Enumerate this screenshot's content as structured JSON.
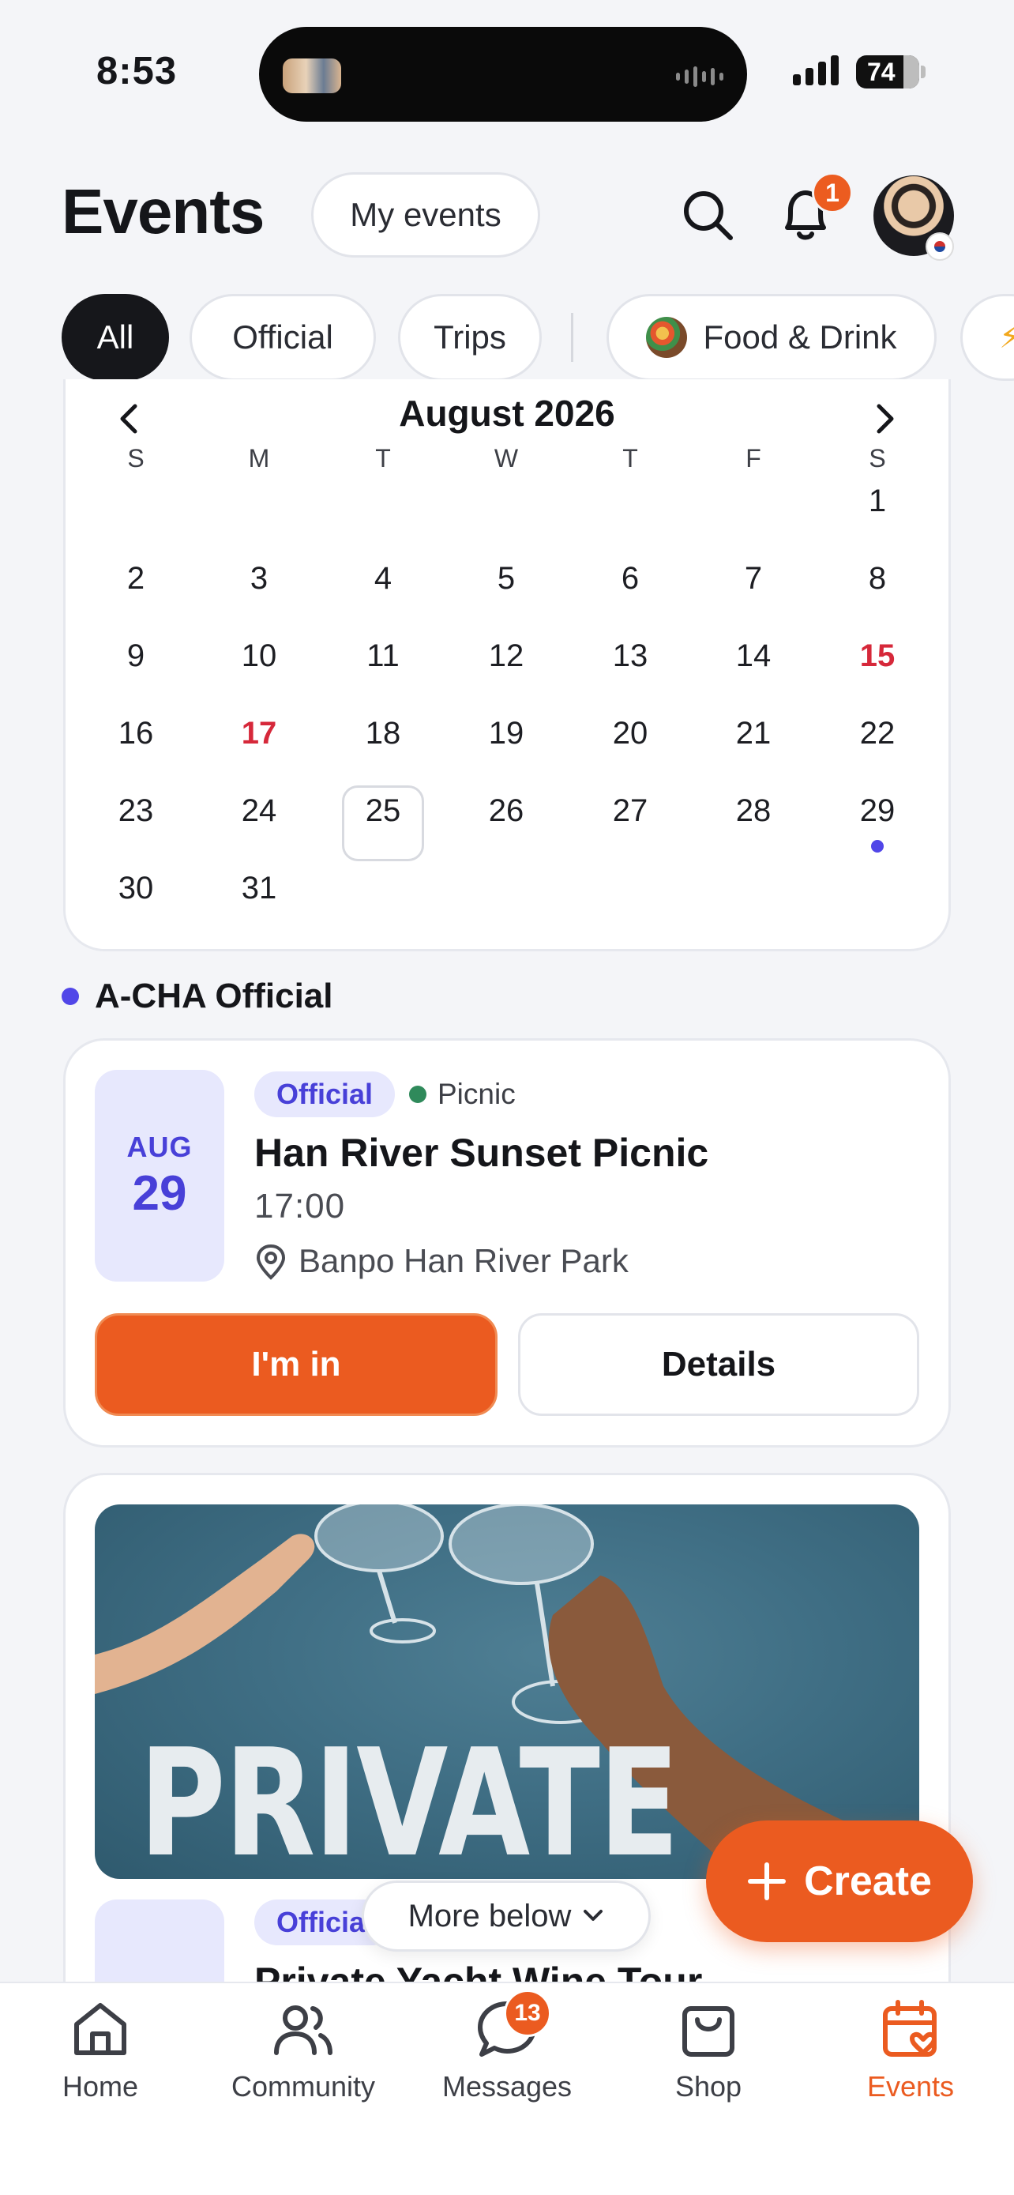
{
  "status_bar": {
    "time": "8:53",
    "battery": "74"
  },
  "header": {
    "title": "Events",
    "my_events_label": "My events",
    "notification_count": "1"
  },
  "filters": [
    {
      "label": "All",
      "active": true
    },
    {
      "label": "Official",
      "active": false
    },
    {
      "label": "Trips",
      "active": false
    },
    {
      "label": "Food & Drink",
      "active": false
    }
  ],
  "calendar": {
    "month_label": "August 2026",
    "weekdays": [
      "S",
      "M",
      "T",
      "W",
      "T",
      "F",
      "S"
    ],
    "weeks": [
      [
        "",
        "",
        "",
        "",
        "",
        "",
        "1"
      ],
      [
        "2",
        "3",
        "4",
        "5",
        "6",
        "7",
        "8"
      ],
      [
        "9",
        "10",
        "11",
        "12",
        "13",
        "14",
        "15"
      ],
      [
        "16",
        "17",
        "18",
        "19",
        "20",
        "21",
        "22"
      ],
      [
        "23",
        "24",
        "25",
        "26",
        "27",
        "28",
        "29"
      ],
      [
        "30",
        "31",
        "",
        "",
        "",
        "",
        ""
      ]
    ],
    "holidays": [
      "15",
      "17"
    ],
    "selected_day": "25",
    "event_days": [
      "29"
    ],
    "accent_color": "#5146e8",
    "holiday_color": "#d6283a"
  },
  "section": {
    "label": "A-CHA Official"
  },
  "event_card": {
    "month": "AUG",
    "day": "29",
    "tag": "Official",
    "category": "Picnic",
    "title": "Han River Sunset Picnic",
    "time": "17:00",
    "location": "Banpo Han River Park",
    "primary_button": "I'm in",
    "secondary_button": "Details"
  },
  "event_card_2": {
    "image_text": "PRIVATE",
    "tag": "Official",
    "title": "Private Yacht Wine Tour"
  },
  "more_below_label": "More below",
  "fab_label": "Create",
  "tabbar": {
    "items": [
      {
        "label": "Home",
        "icon": "home-icon"
      },
      {
        "label": "Community",
        "icon": "community-icon"
      },
      {
        "label": "Messages",
        "icon": "messages-icon"
      },
      {
        "label": "Shop",
        "icon": "shop-icon"
      },
      {
        "label": "Events",
        "icon": "calendar-heart-icon"
      }
    ],
    "messages_badge": "13",
    "active_color": "#eb5b20"
  }
}
